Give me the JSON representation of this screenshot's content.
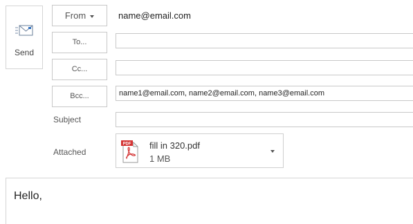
{
  "send": {
    "label": "Send",
    "icon": "send-envelope-icon"
  },
  "header": {
    "from_label": "From",
    "from_value": "name@email.com",
    "to_label": "To...",
    "to_value": "",
    "cc_label": "Cc...",
    "cc_value": "",
    "bcc_label": "Bcc...",
    "bcc_value": "name1@email.com, name2@email.com, name3@email.com",
    "subject_label": "Subject",
    "subject_value": ""
  },
  "attachment": {
    "label": "Attached",
    "file_name": "fill in 320.pdf",
    "file_size": "1 MB",
    "icon": "pdf-file-icon",
    "icon_badge": "PDF",
    "badge_color": "#d32f2f"
  },
  "message": {
    "body": "Hello,"
  }
}
